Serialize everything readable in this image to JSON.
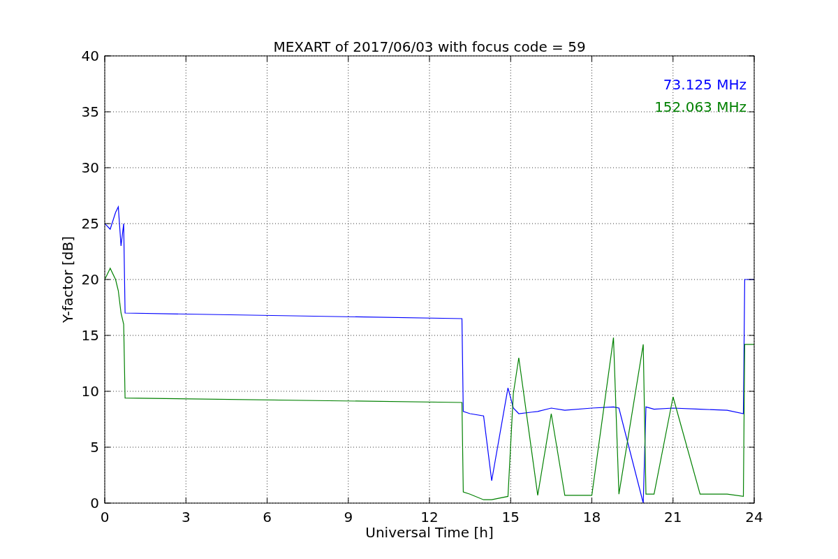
{
  "figure": {
    "chart_data": {
      "type": "line",
      "title": "MEXART of 2017/06/03 with focus code = 59",
      "xlabel": "Universal Time [h]",
      "ylabel": "Y-factor [dB]",
      "x": [
        0,
        0.2,
        0.4,
        0.5,
        0.6,
        0.7,
        0.75,
        13.2,
        13.25,
        13.5,
        14,
        14.3,
        14.9,
        15.1,
        15.3,
        16,
        16.5,
        17,
        18,
        18.8,
        19,
        19.9,
        20,
        20.3,
        21,
        22,
        23,
        23.6,
        23.65,
        24
      ],
      "series": [
        {
          "name": "73.125 MHz",
          "color": "#0000ff",
          "values": [
            25,
            24.5,
            26,
            26.5,
            23,
            25,
            17,
            16.5,
            8.2,
            8,
            7.8,
            2,
            10.3,
            8.5,
            8,
            8.2,
            8.5,
            8.3,
            8.5,
            8.6,
            8.5,
            0,
            8.6,
            8.4,
            8.5,
            8.4,
            8.3,
            8,
            20,
            20
          ]
        },
        {
          "name": "152.063 MHz",
          "color": "#008000",
          "values": [
            20,
            21,
            20,
            19,
            17,
            16,
            9.4,
            9,
            1,
            0.8,
            0.3,
            0.3,
            0.6,
            9.8,
            13,
            0.7,
            8,
            0.7,
            0.7,
            14.8,
            0.8,
            14.2,
            0.8,
            0.8,
            9.5,
            0.8,
            0.8,
            0.6,
            14.2,
            14.2
          ]
        }
      ],
      "grid": true,
      "xlim": [
        0,
        24
      ],
      "ylim": [
        0,
        40
      ],
      "xticks": [
        0,
        3,
        6,
        9,
        12,
        15,
        18,
        21,
        24
      ],
      "yticks": [
        0,
        5,
        10,
        15,
        20,
        25,
        30,
        35,
        40
      ]
    }
  }
}
